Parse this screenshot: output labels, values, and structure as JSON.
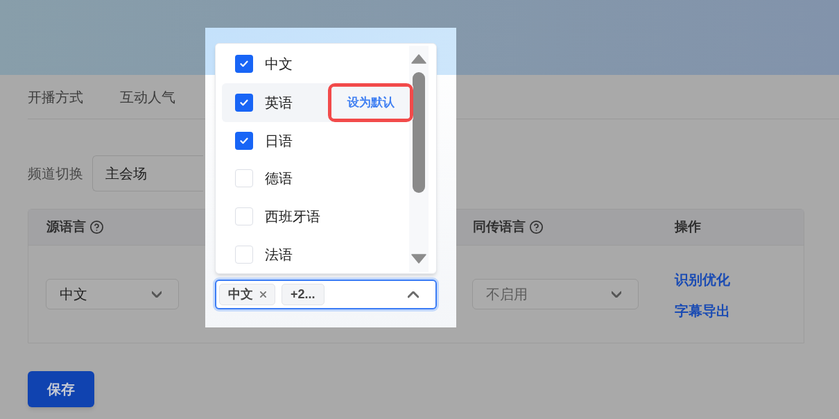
{
  "tabs": [
    {
      "label": "开播方式",
      "selected": false
    },
    {
      "label": "互动人气",
      "selected": false
    }
  ],
  "channel": {
    "label": "频道切换",
    "value": "主会场"
  },
  "table": {
    "columns": [
      {
        "label": "源语言",
        "help": true
      },
      {
        "label": "同传语言",
        "help": true
      },
      {
        "label": "操作"
      }
    ],
    "rows": [
      {
        "source_language": "中文",
        "interpretation": {
          "placeholder": "不启用"
        },
        "actions": [
          "识别优化",
          "字幕导出"
        ]
      }
    ]
  },
  "save_button": "保存",
  "language_dropdown": {
    "expanded": true,
    "options": [
      {
        "label": "中文",
        "checked": true,
        "hovered": false
      },
      {
        "label": "英语",
        "checked": true,
        "hovered": true,
        "action": "设为默认",
        "highlighted": true
      },
      {
        "label": "日语",
        "checked": true,
        "hovered": false
      },
      {
        "label": "德语",
        "checked": false,
        "hovered": false
      },
      {
        "label": "西班牙语",
        "checked": false,
        "hovered": false
      },
      {
        "label": "法语",
        "checked": false,
        "hovered": false
      }
    ],
    "tags": [
      {
        "label": "中文",
        "removable": true
      },
      {
        "label": "+2...",
        "removable": false
      }
    ]
  }
}
